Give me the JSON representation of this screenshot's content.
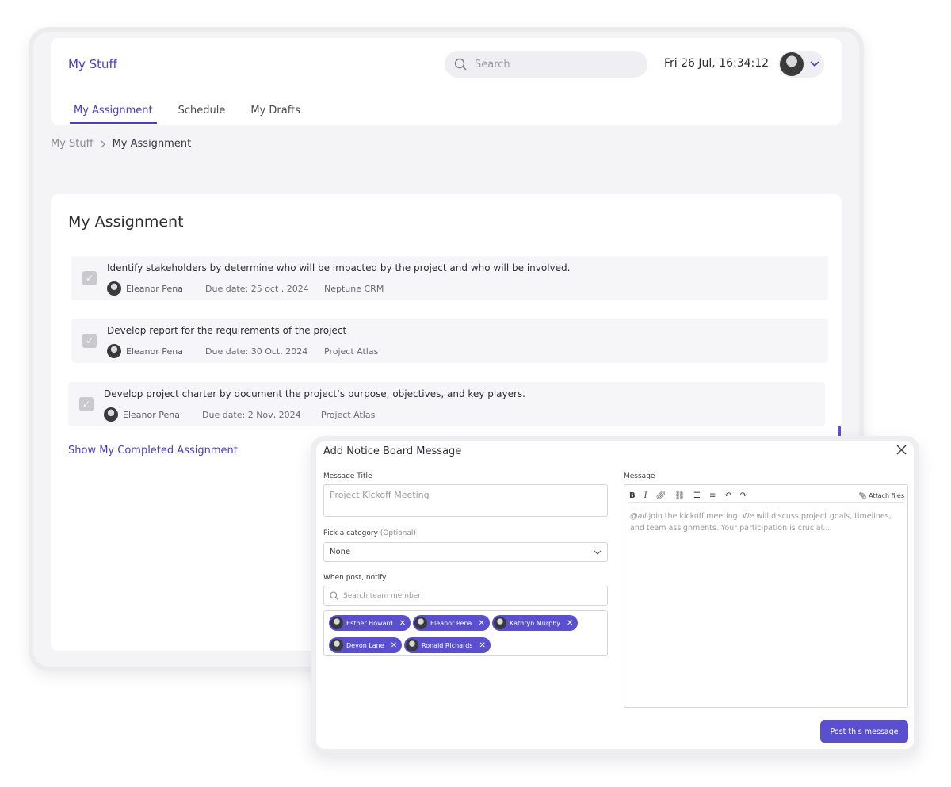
{
  "app": {
    "brand": "My Stuff",
    "search_placeholder": "Search",
    "datetime": "Fri 26 Jul, 16:34:12"
  },
  "tabs": [
    {
      "label": "My Assignment",
      "active": true
    },
    {
      "label": "Schedule",
      "active": false
    },
    {
      "label": "My Drafts",
      "active": false
    }
  ],
  "breadcrumb": {
    "root": "My Stuff",
    "current": "My Assignment"
  },
  "assignments": {
    "title": "My Assignment",
    "items": [
      {
        "title": "Identify stakeholders by determine who will be impacted by the project and who will be involved.",
        "assignee": "Eleanor Pena",
        "due": "Due date: 25 oct , 2024",
        "project": "Neptune CRM",
        "checked": true
      },
      {
        "title": "Develop report for the requirements of the project",
        "assignee": "Eleanor Pena",
        "due": "Due date: 30 Oct, 2024",
        "project": "Project Atlas",
        "checked": true
      },
      {
        "title": "Develop project charter by document the project’s purpose, objectives, and key players.",
        "assignee": "Eleanor Pena",
        "due": "Due date: 2 Nov, 2024",
        "project": "Project Atlas",
        "checked": true
      }
    ],
    "show_completed": "Show My Completed Assignment"
  },
  "modal": {
    "title": "Add Notice Board Message",
    "message_title_label": "Message Title",
    "message_title_placeholder": "Project Kickoff Meeting",
    "category_label": "Pick a category",
    "category_optional": "(Optional)",
    "category_value": "None",
    "notify_label": "When post, notify",
    "notify_search_placeholder": "Search team member",
    "notify_chips": [
      "Esther Howard",
      "Eleanor Pena",
      "Kathryn Murphy",
      "Devon Lane",
      "Ronald Richards"
    ],
    "message_label": "Message",
    "attach_label": "Attach files",
    "message_mention": "@all",
    "message_body": " join the kickoff meeting. We will discuss project goals, timelines, and team assignments. Your participation is crucial...",
    "post_button": "Post this message"
  },
  "colors": {
    "accent": "#5a4fcf",
    "brand": "#4b3fbf"
  }
}
